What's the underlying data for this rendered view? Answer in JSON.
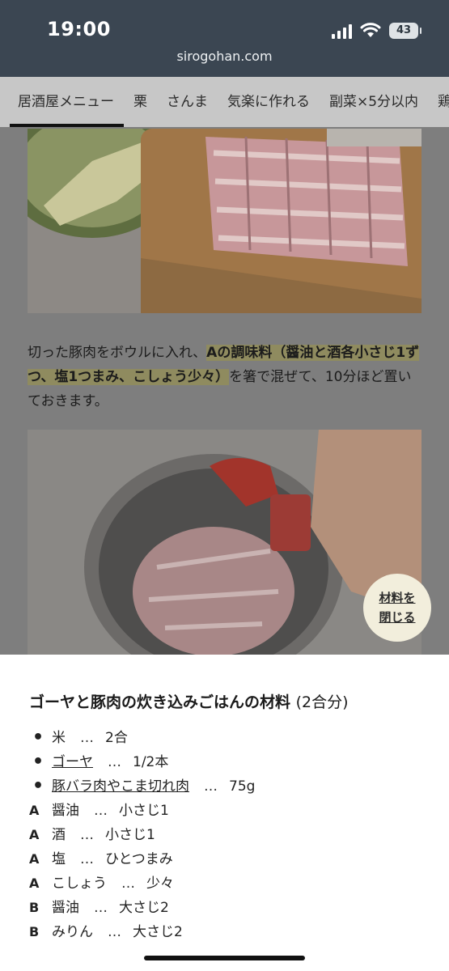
{
  "status_bar": {
    "time": "19:00",
    "battery": "43"
  },
  "browser": {
    "url": "sirogohan.com"
  },
  "category_nav": [
    "居酒屋メニュー",
    "栗",
    "さんま",
    "気楽に作れる",
    "副菜×5分以内",
    "鶏肉"
  ],
  "article": {
    "text_plain_1": "切った豚肉をボウルに入れ、",
    "text_highlight": "Aの調味料（醤油と酒各小さじ1ずつ、塩1つまみ、こしょう少々）",
    "text_plain_2": "を箸で混ぜて、10分ほど置いておきます。"
  },
  "close_button": {
    "line1": "材料を",
    "line2": "閉じる"
  },
  "ingredients": {
    "title": "ゴーヤと豚肉の炊き込みごはんの材料",
    "servings": "(2合分)",
    "items": [
      {
        "mark": "•",
        "name": "米",
        "sep": "…",
        "amount": "2合"
      },
      {
        "mark": "•",
        "name": "ゴーヤ",
        "sep": "…",
        "amount": "1/2本"
      },
      {
        "mark": "•",
        "name": "豚バラ肉やこま切れ肉",
        "sep": "…",
        "amount": "75g"
      },
      {
        "mark": "A",
        "name": "醤油",
        "sep": "…",
        "amount": "小さじ1"
      },
      {
        "mark": "A",
        "name": "酒",
        "sep": "…",
        "amount": "小さじ1"
      },
      {
        "mark": "A",
        "name": "塩",
        "sep": "…",
        "amount": "ひとつまみ"
      },
      {
        "mark": "A",
        "name": "こしょう",
        "sep": "…",
        "amount": "少々"
      },
      {
        "mark": "B",
        "name": "醤油",
        "sep": "…",
        "amount": "大さじ2"
      },
      {
        "mark": "B",
        "name": "みりん",
        "sep": "…",
        "amount": "大さじ2"
      }
    ]
  },
  "colors": {
    "topbar": "#3b4652",
    "nav": "#c7c7c7",
    "dim": "#7e7e7e",
    "close_button": "#f2eedc"
  }
}
